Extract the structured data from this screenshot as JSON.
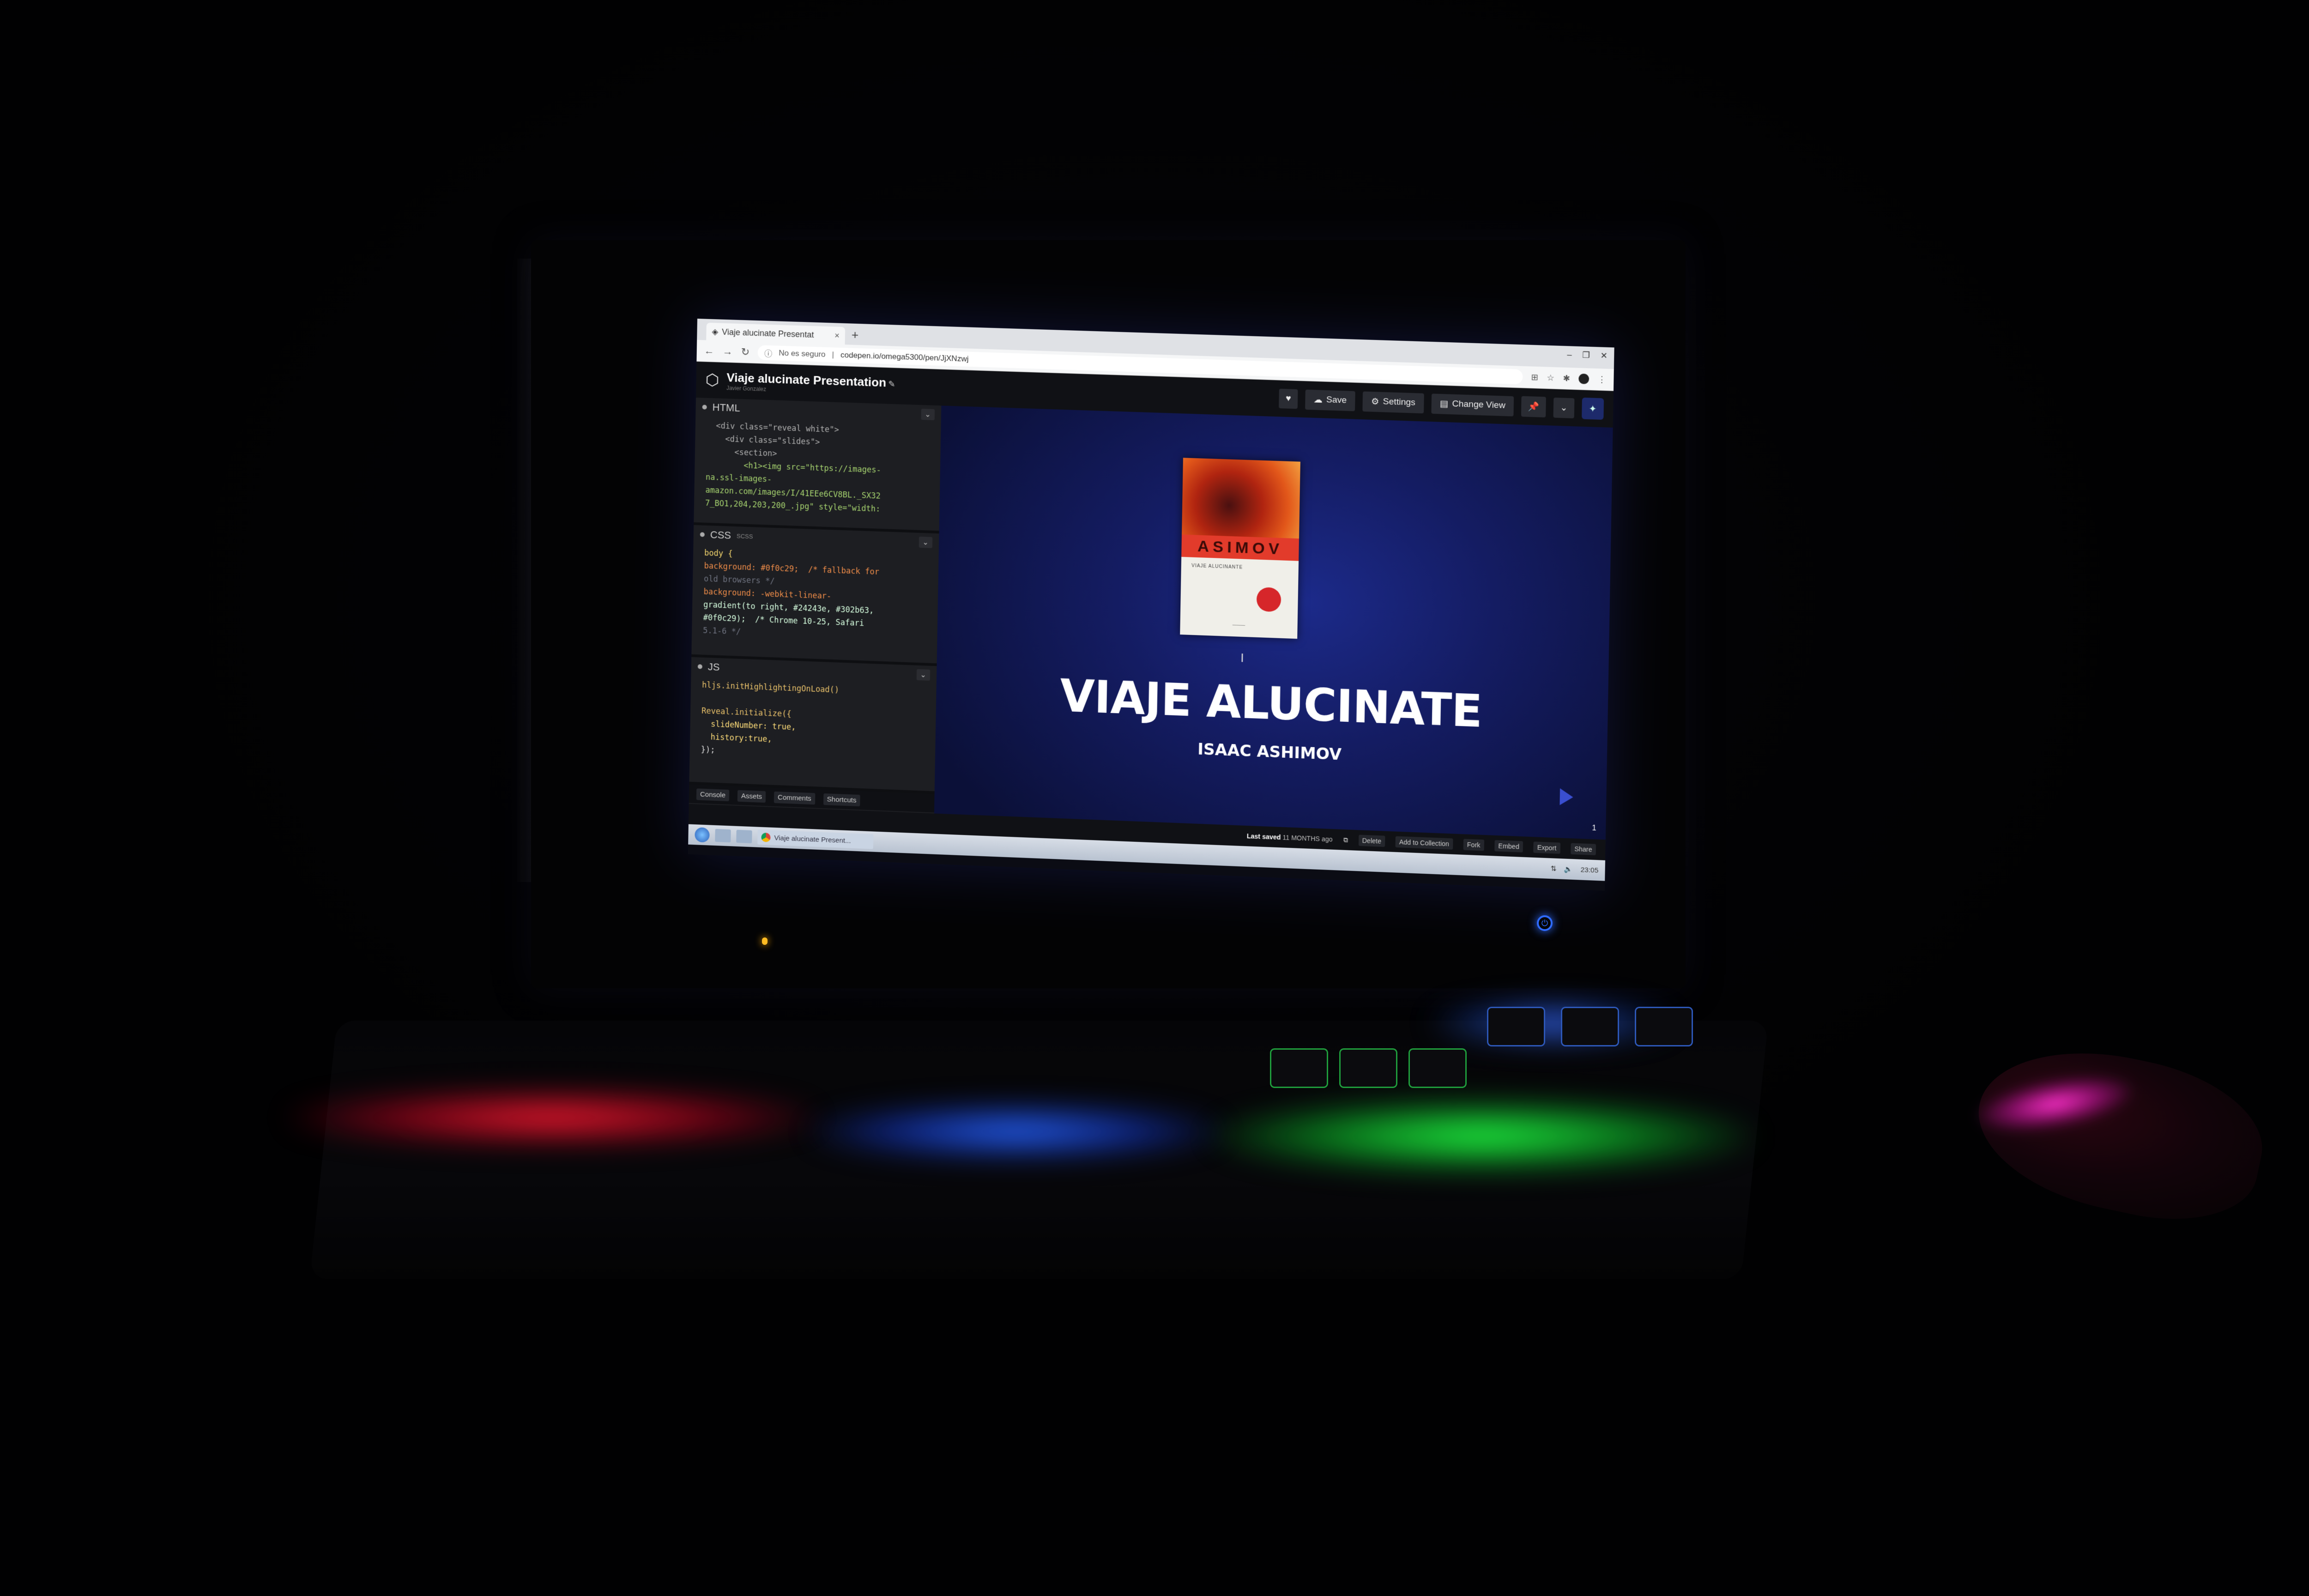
{
  "browser": {
    "tab_title": "Viaje alucinate Presentat",
    "tab_close": "×",
    "new_tab": "+",
    "security_label": "No es seguro",
    "url": "codepen.io/omega5300/pen/JjXNzwj"
  },
  "codepen": {
    "pen_title": "Viaje alucinate Presentation",
    "author": "Javier Gonzalez",
    "buttons": {
      "heart": "♥",
      "save": "Save",
      "settings": "Settings",
      "change_view": "Change View"
    },
    "editors": {
      "html": {
        "label": "HTML",
        "preprocessor": ""
      },
      "css": {
        "label": "CSS",
        "preprocessor": "SCSS"
      },
      "js": {
        "label": "JS",
        "preprocessor": ""
      }
    },
    "bottom_tabs": [
      "Console",
      "Assets",
      "Comments",
      "Shortcuts"
    ],
    "footer": {
      "last_saved_label": "Last saved",
      "last_saved_value": "11 MONTHS ago",
      "actions": [
        "Delete",
        "Add to Collection",
        "Fork",
        "Embed",
        "Export",
        "Share"
      ]
    }
  },
  "code": {
    "html": [
      "  <div class=\"reveal white\">",
      "    <div class=\"slides\">",
      "      <section>",
      "        <h1><img src=\"https://images-",
      "na.ssl-images-",
      "amazon.com/images/I/41EEe6CV8BL._SX32",
      "7_BO1,204,203,200_.jpg\" style=\"width:"
    ],
    "css": [
      "body {",
      "background: #0f0c29;  /* fallback for",
      "old browsers */",
      "background: -webkit-linear-",
      "gradient(to right, #24243e, #302b63,",
      "#0f0c29);  /* Chrome 10-25, Safari",
      "5.1-6 */"
    ],
    "js": [
      "hljs.initHighlightingOnLoad()",
      "",
      "Reveal.initialize({",
      "  slideNumber: true,",
      "  history:true,",
      "});"
    ]
  },
  "slide": {
    "book_author_band": "ASIMOV",
    "book_title_small": "VIAJE ALUCINANTE",
    "title": "VIAJE ALUCINATE",
    "subtitle": "ISAAC ASHIMOV",
    "slide_number": "1"
  },
  "taskbar": {
    "task_label": "Viaje alucinate Present...",
    "clock": "23:05"
  },
  "colors": {
    "slide_bg_center": "#1c2a8a",
    "slide_bg_edge": "#0b1038",
    "editor_bg": "#1d1e22",
    "power_led": "#2f6bff",
    "keyboard_red": "#ff2035",
    "keyboard_blue": "#2a6bff",
    "keyboard_green": "#22ff44",
    "mouse_magenta": "#ff33cc"
  }
}
